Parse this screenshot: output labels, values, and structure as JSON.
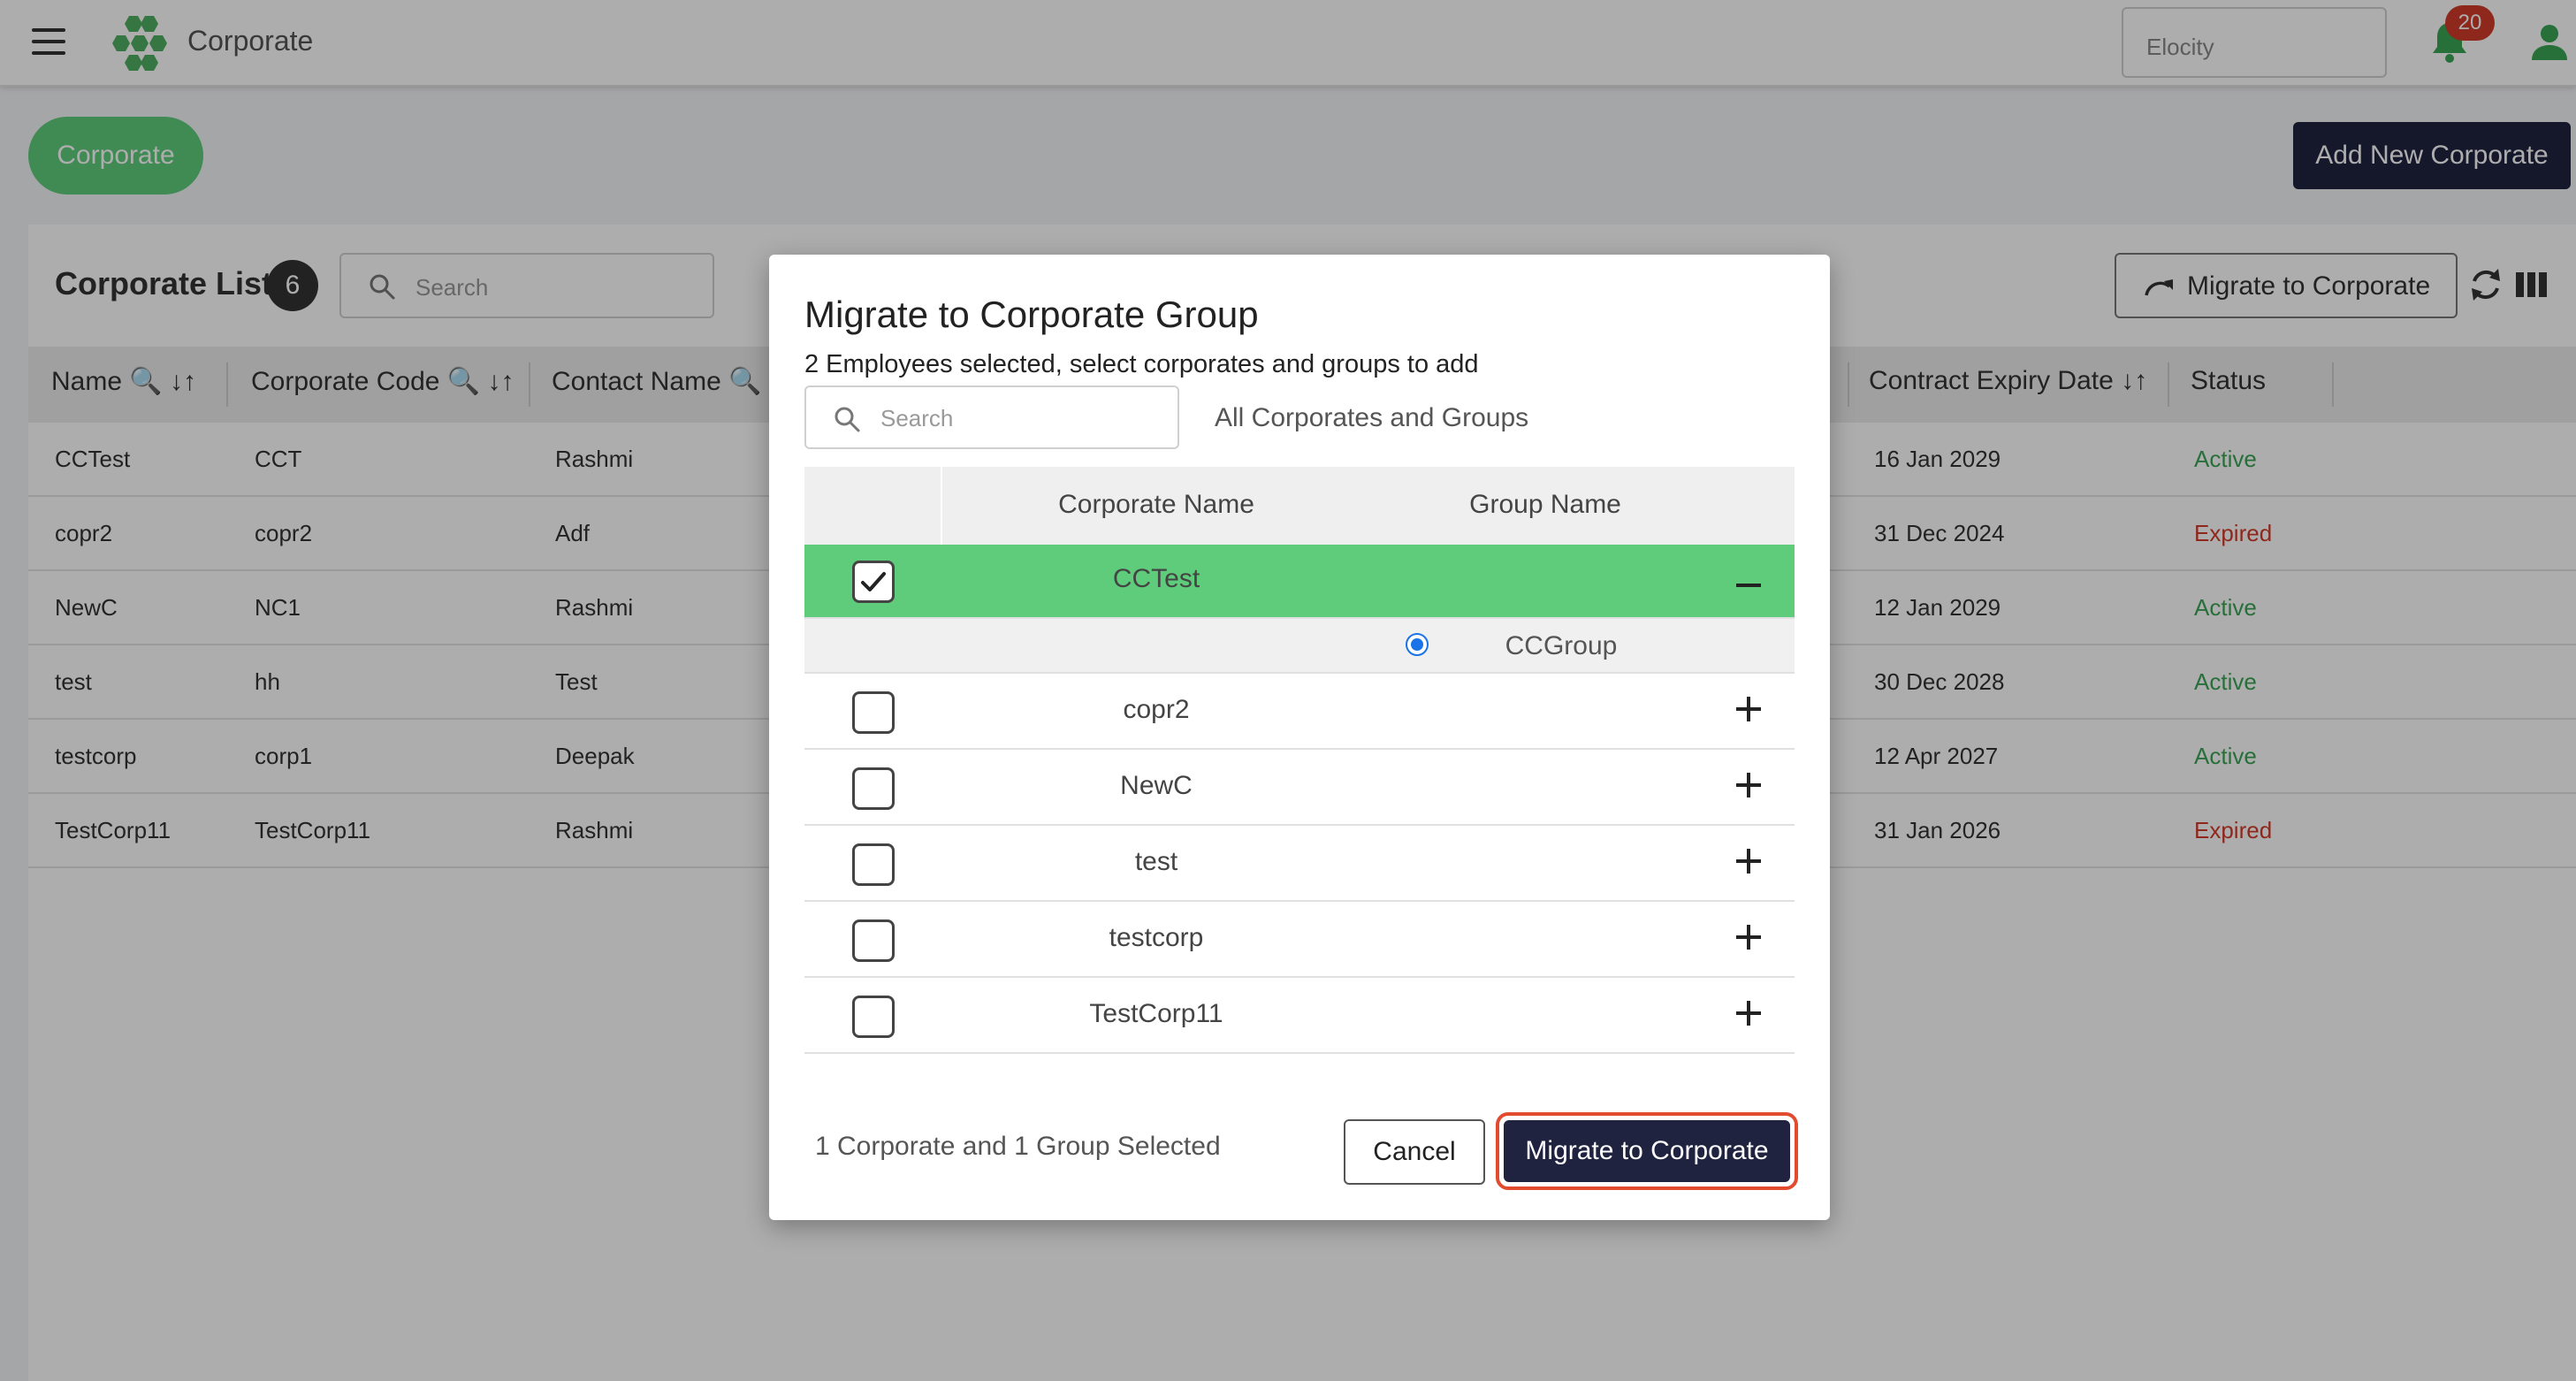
{
  "header": {
    "app_title": "Corporate",
    "org_select_value": "Elocity",
    "notification_count": "20"
  },
  "page": {
    "pill_label": "Corporate",
    "add_new_label": "Add New Corporate"
  },
  "list": {
    "title": "Corporate List",
    "count": "6",
    "search_placeholder": "Search",
    "migrate_label": "Migrate to Corporate",
    "columns": {
      "name": "Name",
      "corporate_code": "Corporate Code",
      "contact_name": "Contact Name",
      "contract_expiry": "Contract Expiry Date",
      "status": "Status"
    },
    "rows": [
      {
        "name": "CCTest",
        "code": "CCT",
        "contact": "Rashmi",
        "expiry": "16 Jan 2029",
        "status": "Active"
      },
      {
        "name": "copr2",
        "code": "copr2",
        "contact": "Adf",
        "expiry": "31 Dec 2024",
        "status": "Expired"
      },
      {
        "name": "NewC",
        "code": "NC1",
        "contact": "Rashmi",
        "expiry": "12 Jan 2029",
        "status": "Active"
      },
      {
        "name": "test",
        "code": "hh",
        "contact": "Test",
        "expiry": "30 Dec 2028",
        "status": "Active"
      },
      {
        "name": "testcorp",
        "code": "corp1",
        "contact": "Deepak",
        "expiry": "12 Apr 2027",
        "status": "Active"
      },
      {
        "name": "TestCorp11",
        "code": "TestCorp11",
        "contact": "Rashmi",
        "expiry": "31 Jan 2026",
        "status": "Expired"
      }
    ]
  },
  "modal": {
    "title": "Migrate to Corporate Group",
    "subtitle": "2 Employees selected, select corporates and groups to add",
    "search_placeholder": "Search",
    "filter_label": "All Corporates and Groups",
    "col_corporate_name": "Corporate Name",
    "col_group_name": "Group Name",
    "rows": [
      {
        "name": "CCTest",
        "checked": true,
        "expanded": true,
        "group": "CCGroup"
      },
      {
        "name": "copr2",
        "checked": false
      },
      {
        "name": "NewC",
        "checked": false
      },
      {
        "name": "test",
        "checked": false
      },
      {
        "name": "testcorp",
        "checked": false
      },
      {
        "name": "TestCorp11",
        "checked": false
      }
    ],
    "selection_summary": "1 Corporate and 1 Group Selected",
    "cancel_label": "Cancel",
    "migrate_label": "Migrate to Corporate"
  },
  "colors": {
    "accent_green": "#5fcc7c",
    "navy": "#1f2340",
    "active": "#3aa556",
    "expired": "#d23b2b",
    "highlight": "#e34b2f"
  }
}
